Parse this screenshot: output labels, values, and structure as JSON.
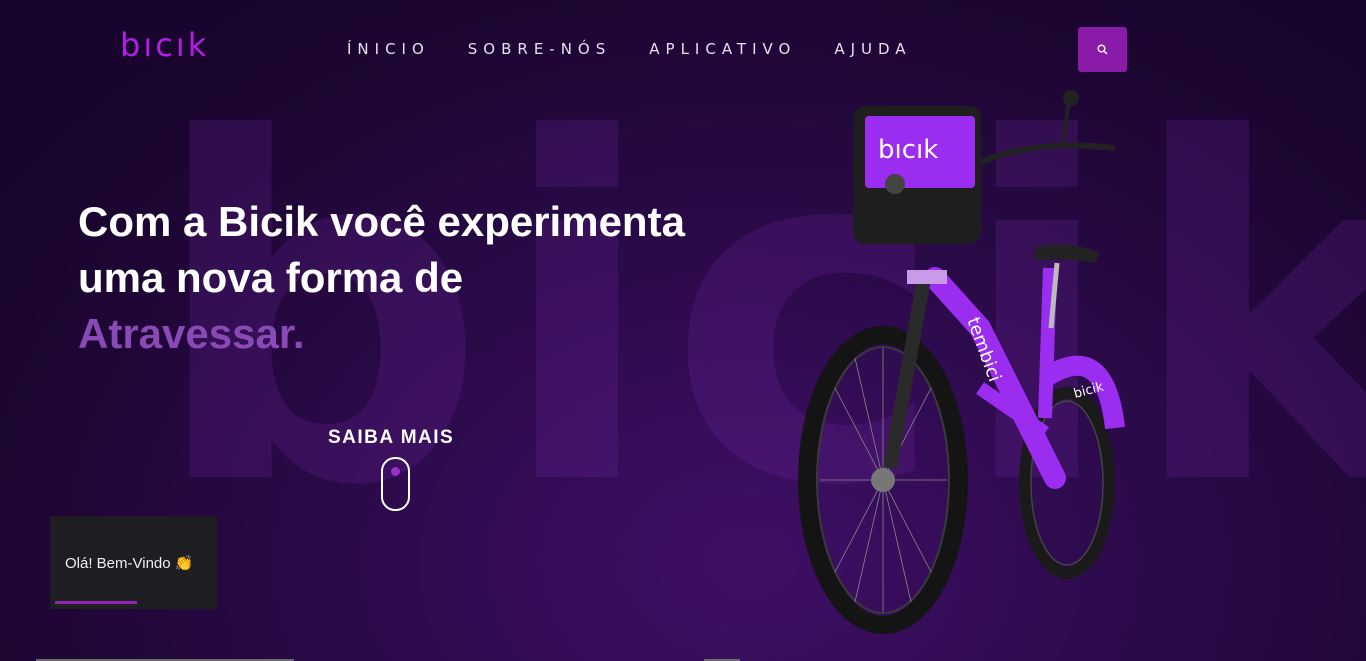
{
  "brand": {
    "logo_text": "bıcık",
    "accent": "#b31ee6"
  },
  "watermark": "bicik",
  "nav": {
    "items": [
      "ÍNICIO",
      "SOBRE-NÓS",
      "APLICATIVO",
      "AJUDA"
    ]
  },
  "search": {
    "icon": "search-icon"
  },
  "hero": {
    "line1": "Com a Bicik você experimenta",
    "line2": "uma nova forma de",
    "accent_word": "Atravessar."
  },
  "cta": {
    "label": "SAIBA MAIS"
  },
  "toast": {
    "message": "Olá! Bem-Vindo 👏"
  },
  "bike": {
    "basket_text": "bıcık",
    "frame_text": "tembici",
    "fender_text": "bicik"
  }
}
